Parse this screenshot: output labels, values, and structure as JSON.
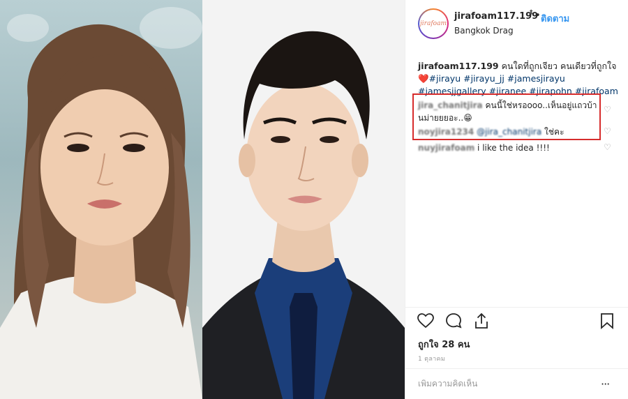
{
  "post": {
    "avatar_text": "jirafoam",
    "username": "jirafoam117.199",
    "stepper_icon": "⬍",
    "follow_label": "ติดตาม",
    "location": "Bangkok Drag"
  },
  "caption": {
    "username": "jirafoam117.199",
    "text": "คนใดที่ถูกเจียว คนเดียวที่ถูกใจ",
    "heart": "❤️",
    "hashtags": "#jirayu #jirayu_jj #jamesjirayu #jamesjjgallery #jiranee #jirapohn #jirafoam"
  },
  "comments": [
    {
      "user": "jira_chanitjira",
      "text": "คนนี้ใช่หรอooo..เห็นอยู่แถวบ้านม่ายยยอะ..😁"
    },
    {
      "user": "noyjira1234",
      "mention": "@jira_chanitjira",
      "text": "ใช่คะ"
    },
    {
      "user": "nuyjirafoam",
      "text": "i like the idea !!!!"
    }
  ],
  "actions": {
    "likes": "ถูกใจ 28 คน",
    "date": "1 ตุลาคม",
    "add_comment_placeholder": "เพิ่มความคิดเห็น",
    "more_icon": "···"
  },
  "colors": {
    "accent": "#3897f0",
    "highlight": "#d62c2c"
  }
}
